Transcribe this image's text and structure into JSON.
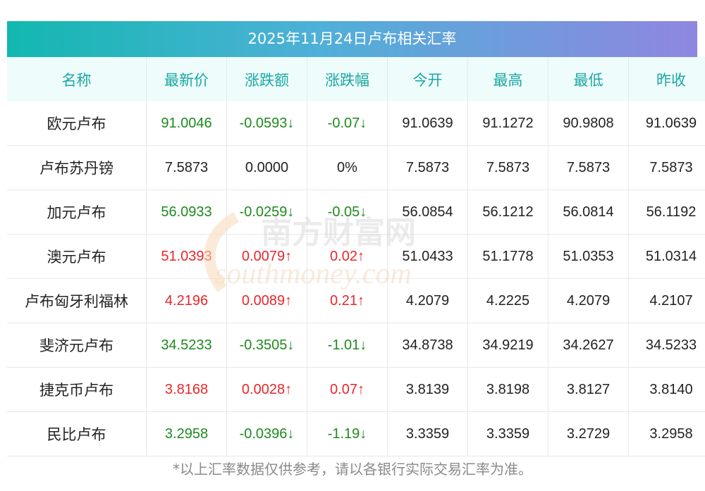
{
  "title": "2025年11月24日卢布相关汇率",
  "headers": [
    "名称",
    "最新价",
    "涨跌额",
    "涨跌幅",
    "今开",
    "最高",
    "最低",
    "昨收"
  ],
  "rows": [
    {
      "name": "欧元卢布",
      "latest": "91.0046",
      "change": "-0.0593↓",
      "pct": "-0.07↓",
      "open": "91.0639",
      "high": "91.1272",
      "low": "90.9808",
      "prev": "91.0639",
      "trend": "down"
    },
    {
      "name": "卢布苏丹镑",
      "latest": "7.5873",
      "change": "0.0000",
      "pct": "0%",
      "open": "7.5873",
      "high": "7.5873",
      "low": "7.5873",
      "prev": "7.5873",
      "trend": "flat"
    },
    {
      "name": "加元卢布",
      "latest": "56.0933",
      "change": "-0.0259↓",
      "pct": "-0.05↓",
      "open": "56.0854",
      "high": "56.1212",
      "low": "56.0814",
      "prev": "56.1192",
      "trend": "down"
    },
    {
      "name": "澳元卢布",
      "latest": "51.0393",
      "change": "0.0079↑",
      "pct": "0.02↑",
      "open": "51.0433",
      "high": "51.1778",
      "low": "51.0353",
      "prev": "51.0314",
      "trend": "up"
    },
    {
      "name": "卢布匈牙利福林",
      "latest": "4.2196",
      "change": "0.0089↑",
      "pct": "0.21↑",
      "open": "4.2079",
      "high": "4.2225",
      "low": "4.2079",
      "prev": "4.2107",
      "trend": "up"
    },
    {
      "name": "斐济元卢布",
      "latest": "34.5233",
      "change": "-0.3505↓",
      "pct": "-1.01↓",
      "open": "34.8738",
      "high": "34.9219",
      "low": "34.2627",
      "prev": "34.5233",
      "trend": "down"
    },
    {
      "name": "捷克币卢布",
      "latest": "3.8168",
      "change": "0.0028↑",
      "pct": "0.07↑",
      "open": "3.8139",
      "high": "3.8198",
      "low": "3.8127",
      "prev": "3.8140",
      "trend": "up"
    },
    {
      "name": "民比卢布",
      "latest": "3.2958",
      "change": "-0.0396↓",
      "pct": "-1.19↓",
      "open": "3.3359",
      "high": "3.3359",
      "low": "3.2729",
      "prev": "3.2958",
      "trend": "down"
    }
  ],
  "colors": {
    "up": "#e8262a",
    "down": "#1e8a1e",
    "header_text": "#1aa7a3",
    "title_gradient_start": "#12b8b0",
    "title_gradient_end": "#8f86e0"
  },
  "watermark": {
    "cn": "南方财富网",
    "en": "southmoney.com"
  },
  "footer": "*以上汇率数据仅供参考，请以各银行实际交易汇率为准。"
}
